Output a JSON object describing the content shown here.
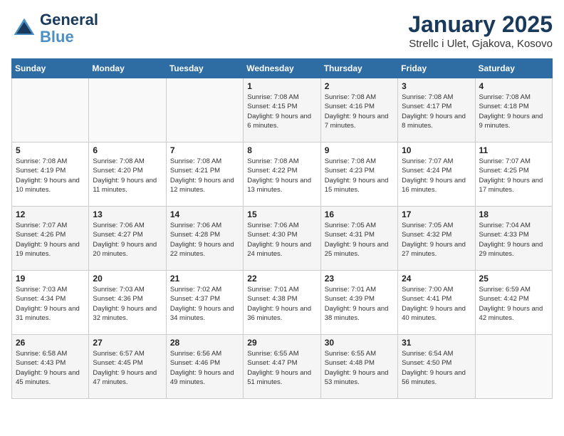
{
  "header": {
    "logo_line1": "General",
    "logo_line2": "Blue",
    "month": "January 2025",
    "location": "Strellc i Ulet, Gjakova, Kosovo"
  },
  "weekdays": [
    "Sunday",
    "Monday",
    "Tuesday",
    "Wednesday",
    "Thursday",
    "Friday",
    "Saturday"
  ],
  "weeks": [
    [
      {
        "day": "",
        "info": ""
      },
      {
        "day": "",
        "info": ""
      },
      {
        "day": "",
        "info": ""
      },
      {
        "day": "1",
        "info": "Sunrise: 7:08 AM\nSunset: 4:15 PM\nDaylight: 9 hours and 6 minutes."
      },
      {
        "day": "2",
        "info": "Sunrise: 7:08 AM\nSunset: 4:16 PM\nDaylight: 9 hours and 7 minutes."
      },
      {
        "day": "3",
        "info": "Sunrise: 7:08 AM\nSunset: 4:17 PM\nDaylight: 9 hours and 8 minutes."
      },
      {
        "day": "4",
        "info": "Sunrise: 7:08 AM\nSunset: 4:18 PM\nDaylight: 9 hours and 9 minutes."
      }
    ],
    [
      {
        "day": "5",
        "info": "Sunrise: 7:08 AM\nSunset: 4:19 PM\nDaylight: 9 hours and 10 minutes."
      },
      {
        "day": "6",
        "info": "Sunrise: 7:08 AM\nSunset: 4:20 PM\nDaylight: 9 hours and 11 minutes."
      },
      {
        "day": "7",
        "info": "Sunrise: 7:08 AM\nSunset: 4:21 PM\nDaylight: 9 hours and 12 minutes."
      },
      {
        "day": "8",
        "info": "Sunrise: 7:08 AM\nSunset: 4:22 PM\nDaylight: 9 hours and 13 minutes."
      },
      {
        "day": "9",
        "info": "Sunrise: 7:08 AM\nSunset: 4:23 PM\nDaylight: 9 hours and 15 minutes."
      },
      {
        "day": "10",
        "info": "Sunrise: 7:07 AM\nSunset: 4:24 PM\nDaylight: 9 hours and 16 minutes."
      },
      {
        "day": "11",
        "info": "Sunrise: 7:07 AM\nSunset: 4:25 PM\nDaylight: 9 hours and 17 minutes."
      }
    ],
    [
      {
        "day": "12",
        "info": "Sunrise: 7:07 AM\nSunset: 4:26 PM\nDaylight: 9 hours and 19 minutes."
      },
      {
        "day": "13",
        "info": "Sunrise: 7:06 AM\nSunset: 4:27 PM\nDaylight: 9 hours and 20 minutes."
      },
      {
        "day": "14",
        "info": "Sunrise: 7:06 AM\nSunset: 4:28 PM\nDaylight: 9 hours and 22 minutes."
      },
      {
        "day": "15",
        "info": "Sunrise: 7:06 AM\nSunset: 4:30 PM\nDaylight: 9 hours and 24 minutes."
      },
      {
        "day": "16",
        "info": "Sunrise: 7:05 AM\nSunset: 4:31 PM\nDaylight: 9 hours and 25 minutes."
      },
      {
        "day": "17",
        "info": "Sunrise: 7:05 AM\nSunset: 4:32 PM\nDaylight: 9 hours and 27 minutes."
      },
      {
        "day": "18",
        "info": "Sunrise: 7:04 AM\nSunset: 4:33 PM\nDaylight: 9 hours and 29 minutes."
      }
    ],
    [
      {
        "day": "19",
        "info": "Sunrise: 7:03 AM\nSunset: 4:34 PM\nDaylight: 9 hours and 31 minutes."
      },
      {
        "day": "20",
        "info": "Sunrise: 7:03 AM\nSunset: 4:36 PM\nDaylight: 9 hours and 32 minutes."
      },
      {
        "day": "21",
        "info": "Sunrise: 7:02 AM\nSunset: 4:37 PM\nDaylight: 9 hours and 34 minutes."
      },
      {
        "day": "22",
        "info": "Sunrise: 7:01 AM\nSunset: 4:38 PM\nDaylight: 9 hours and 36 minutes."
      },
      {
        "day": "23",
        "info": "Sunrise: 7:01 AM\nSunset: 4:39 PM\nDaylight: 9 hours and 38 minutes."
      },
      {
        "day": "24",
        "info": "Sunrise: 7:00 AM\nSunset: 4:41 PM\nDaylight: 9 hours and 40 minutes."
      },
      {
        "day": "25",
        "info": "Sunrise: 6:59 AM\nSunset: 4:42 PM\nDaylight: 9 hours and 42 minutes."
      }
    ],
    [
      {
        "day": "26",
        "info": "Sunrise: 6:58 AM\nSunset: 4:43 PM\nDaylight: 9 hours and 45 minutes."
      },
      {
        "day": "27",
        "info": "Sunrise: 6:57 AM\nSunset: 4:45 PM\nDaylight: 9 hours and 47 minutes."
      },
      {
        "day": "28",
        "info": "Sunrise: 6:56 AM\nSunset: 4:46 PM\nDaylight: 9 hours and 49 minutes."
      },
      {
        "day": "29",
        "info": "Sunrise: 6:55 AM\nSunset: 4:47 PM\nDaylight: 9 hours and 51 minutes."
      },
      {
        "day": "30",
        "info": "Sunrise: 6:55 AM\nSunset: 4:48 PM\nDaylight: 9 hours and 53 minutes."
      },
      {
        "day": "31",
        "info": "Sunrise: 6:54 AM\nSunset: 4:50 PM\nDaylight: 9 hours and 56 minutes."
      },
      {
        "day": "",
        "info": ""
      }
    ]
  ]
}
